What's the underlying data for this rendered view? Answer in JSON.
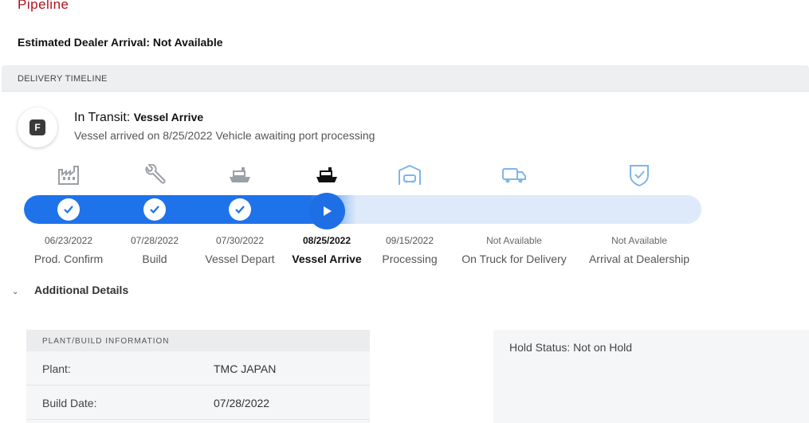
{
  "page": {
    "title": "Pipeline",
    "arrival_label": "Estimated Dealer Arrival: Not Available"
  },
  "timeline": {
    "header": "DELIVERY TIMELINE",
    "logo_letter": "F",
    "status_prefix": "In Transit:",
    "status_sub": "Vessel Arrive",
    "status_desc": "Vessel arrived on 8/25/2022 Vehicle awaiting port processing",
    "progress_pct": 49,
    "colors": {
      "accent": "#1e73ea",
      "track": "#deeafa",
      "done_icon": "#9aa0a6",
      "future_icon": "#7fb6e8"
    },
    "stages": [
      {
        "name": "prod-confirm",
        "date": "06/23/2022",
        "label": "Prod. Confirm",
        "state": "done",
        "icon": "factory-icon"
      },
      {
        "name": "build",
        "date": "07/28/2022",
        "label": "Build",
        "state": "done",
        "icon": "wrench-icon"
      },
      {
        "name": "vessel-depart",
        "date": "07/30/2022",
        "label": "Vessel Depart",
        "state": "done",
        "icon": "ship-icon"
      },
      {
        "name": "vessel-arrive",
        "date": "08/25/2022",
        "label": "Vessel Arrive",
        "state": "current",
        "icon": "ship-icon"
      },
      {
        "name": "processing",
        "date": "09/15/2022",
        "label": "Processing",
        "state": "future",
        "icon": "car-port-icon"
      },
      {
        "name": "on-truck",
        "date": "Not Available",
        "label": "On Truck for Delivery",
        "state": "future",
        "icon": "truck-icon"
      },
      {
        "name": "arrival-dealership",
        "date": "Not Available",
        "label": "Arrival at Dealership",
        "state": "future",
        "icon": "shield-check-icon"
      }
    ]
  },
  "details": {
    "toggle_label": "Additional Details",
    "plant_header": "PLANT/BUILD INFORMATION",
    "plant_label": "Plant:",
    "plant_value": "TMC JAPAN",
    "build_label": "Build Date:",
    "build_value": "07/28/2022",
    "hold_status": "Hold Status: Not on Hold"
  }
}
